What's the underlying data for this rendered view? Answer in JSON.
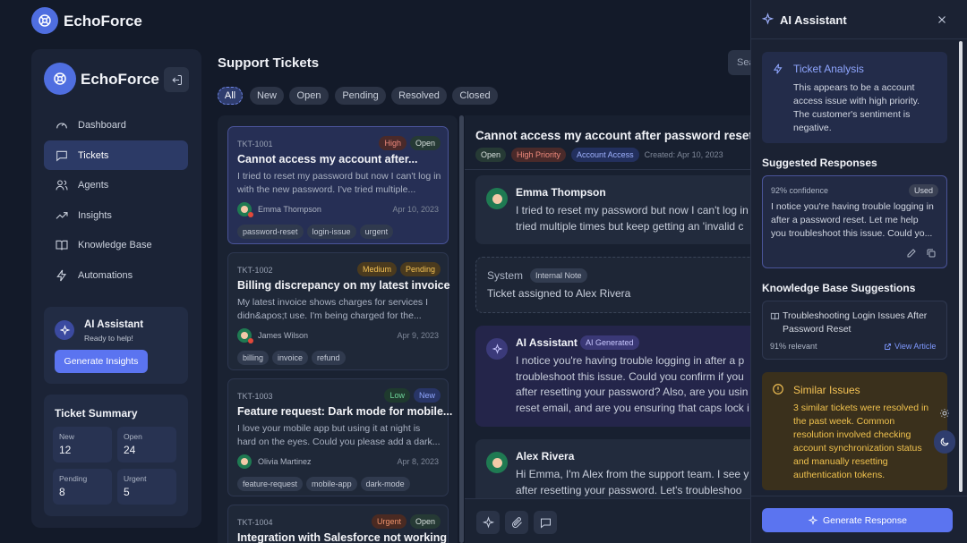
{
  "app": {
    "name": "EchoForce"
  },
  "sidebar": {
    "brand": "EchoForce",
    "nav": [
      {
        "label": "Dashboard",
        "icon": "gauge-icon"
      },
      {
        "label": "Tickets",
        "icon": "message-icon"
      },
      {
        "label": "Agents",
        "icon": "users-icon"
      },
      {
        "label": "Insights",
        "icon": "trending-icon"
      },
      {
        "label": "Knowledge Base",
        "icon": "book-icon"
      },
      {
        "label": "Automations",
        "icon": "bolt-icon"
      }
    ],
    "assistant": {
      "title": "AI Assistant",
      "subtitle": "Ready to help!",
      "button": "Generate Insights"
    },
    "summary": {
      "title": "Ticket Summary",
      "stats": [
        {
          "label": "New",
          "value": "12"
        },
        {
          "label": "Open",
          "value": "24"
        },
        {
          "label": "Pending",
          "value": "8"
        },
        {
          "label": "Urgent",
          "value": "5"
        }
      ]
    }
  },
  "main": {
    "title": "Support Tickets",
    "search_placeholder": "Search",
    "filters": [
      "All",
      "New",
      "Open",
      "Pending",
      "Resolved",
      "Closed"
    ]
  },
  "tickets": [
    {
      "id": "TKT-1001",
      "badges": [
        "High",
        "Open"
      ],
      "title": "Cannot access my account after...",
      "desc": "I tried to reset my password but now I can't log in with the new password. I've tried multiple...",
      "user": "Emma Thompson",
      "date": "Apr 10, 2023",
      "tags": [
        "password-reset",
        "login-issue",
        "urgent"
      ]
    },
    {
      "id": "TKT-1002",
      "badges": [
        "Medium",
        "Pending"
      ],
      "title": "Billing discrepancy on my latest invoice",
      "desc": "My latest invoice shows charges for services I didn&apos;t use. I'm being charged for the...",
      "user": "James Wilson",
      "date": "Apr 9, 2023",
      "tags": [
        "billing",
        "invoice",
        "refund"
      ]
    },
    {
      "id": "TKT-1003",
      "badges": [
        "Low",
        "New"
      ],
      "title": "Feature request: Dark mode for mobile...",
      "desc": "I love your mobile app but using it at night is hard on the eyes. Could you please add a dark...",
      "user": "Olivia Martinez",
      "date": "Apr 8, 2023",
      "tags": [
        "feature-request",
        "mobile-app",
        "dark-mode"
      ]
    },
    {
      "id": "TKT-1004",
      "badges": [
        "Urgent",
        "Open"
      ],
      "title": "Integration with Salesforce not working"
    }
  ],
  "detail": {
    "title": "Cannot access my account after password reset",
    "badges": [
      "Open",
      "High Priority",
      "Account Access"
    ],
    "created": "Created: Apr 10, 2023",
    "messages": [
      {
        "author": "Emma Thompson",
        "lines": [
          "I tried to reset my password but now I can't log in",
          "tried multiple times but keep getting an 'invalid c"
        ]
      },
      {
        "author": "System",
        "badge": "Internal Note",
        "lines": [
          "Ticket assigned to Alex Rivera"
        ]
      },
      {
        "author": "AI Assistant",
        "badge": "AI Generated",
        "lines": [
          "I notice you're having trouble logging in after a p",
          "troubleshoot this issue. Could you confirm if you",
          "after resetting your password? Also, are you usin",
          "reset email, and are you ensuring that caps lock i"
        ]
      },
      {
        "author": "Alex Rivera",
        "lines": [
          "Hi Emma, I'm Alex from the support team. I see y",
          "after resetting your password. Let's troubleshoo"
        ]
      }
    ]
  },
  "ai_panel": {
    "title": "AI Assistant",
    "analysis": {
      "title": "Ticket Analysis",
      "text": [
        "This appears to be a account",
        "access issue with high priority.",
        "The customer's sentiment is",
        "negative."
      ]
    },
    "suggested_title": "Suggested Responses",
    "suggestion": {
      "confidence": "92% confidence",
      "badge": "Used",
      "text": [
        "I notice you're having trouble logging in",
        "after a password reset. Let me help",
        "you troubleshoot this issue. Could yo..."
      ]
    },
    "kb_title": "Knowledge Base Suggestions",
    "kb": {
      "title": [
        "Troubleshooting Login Issues After",
        "Password Reset"
      ],
      "relevance": "91% relevant",
      "link": "View Article"
    },
    "similar": {
      "title": "Similar Issues",
      "text": [
        "3 similar tickets were resolved in",
        "the past week. Common",
        "resolution involved checking",
        "account synchronization status",
        "and manually resetting",
        "authentication tokens."
      ]
    },
    "button": "Generate Response"
  },
  "colors": {
    "accent": "#5b74f0",
    "bg": "#131a29",
    "sidebar": "#1b2336"
  }
}
